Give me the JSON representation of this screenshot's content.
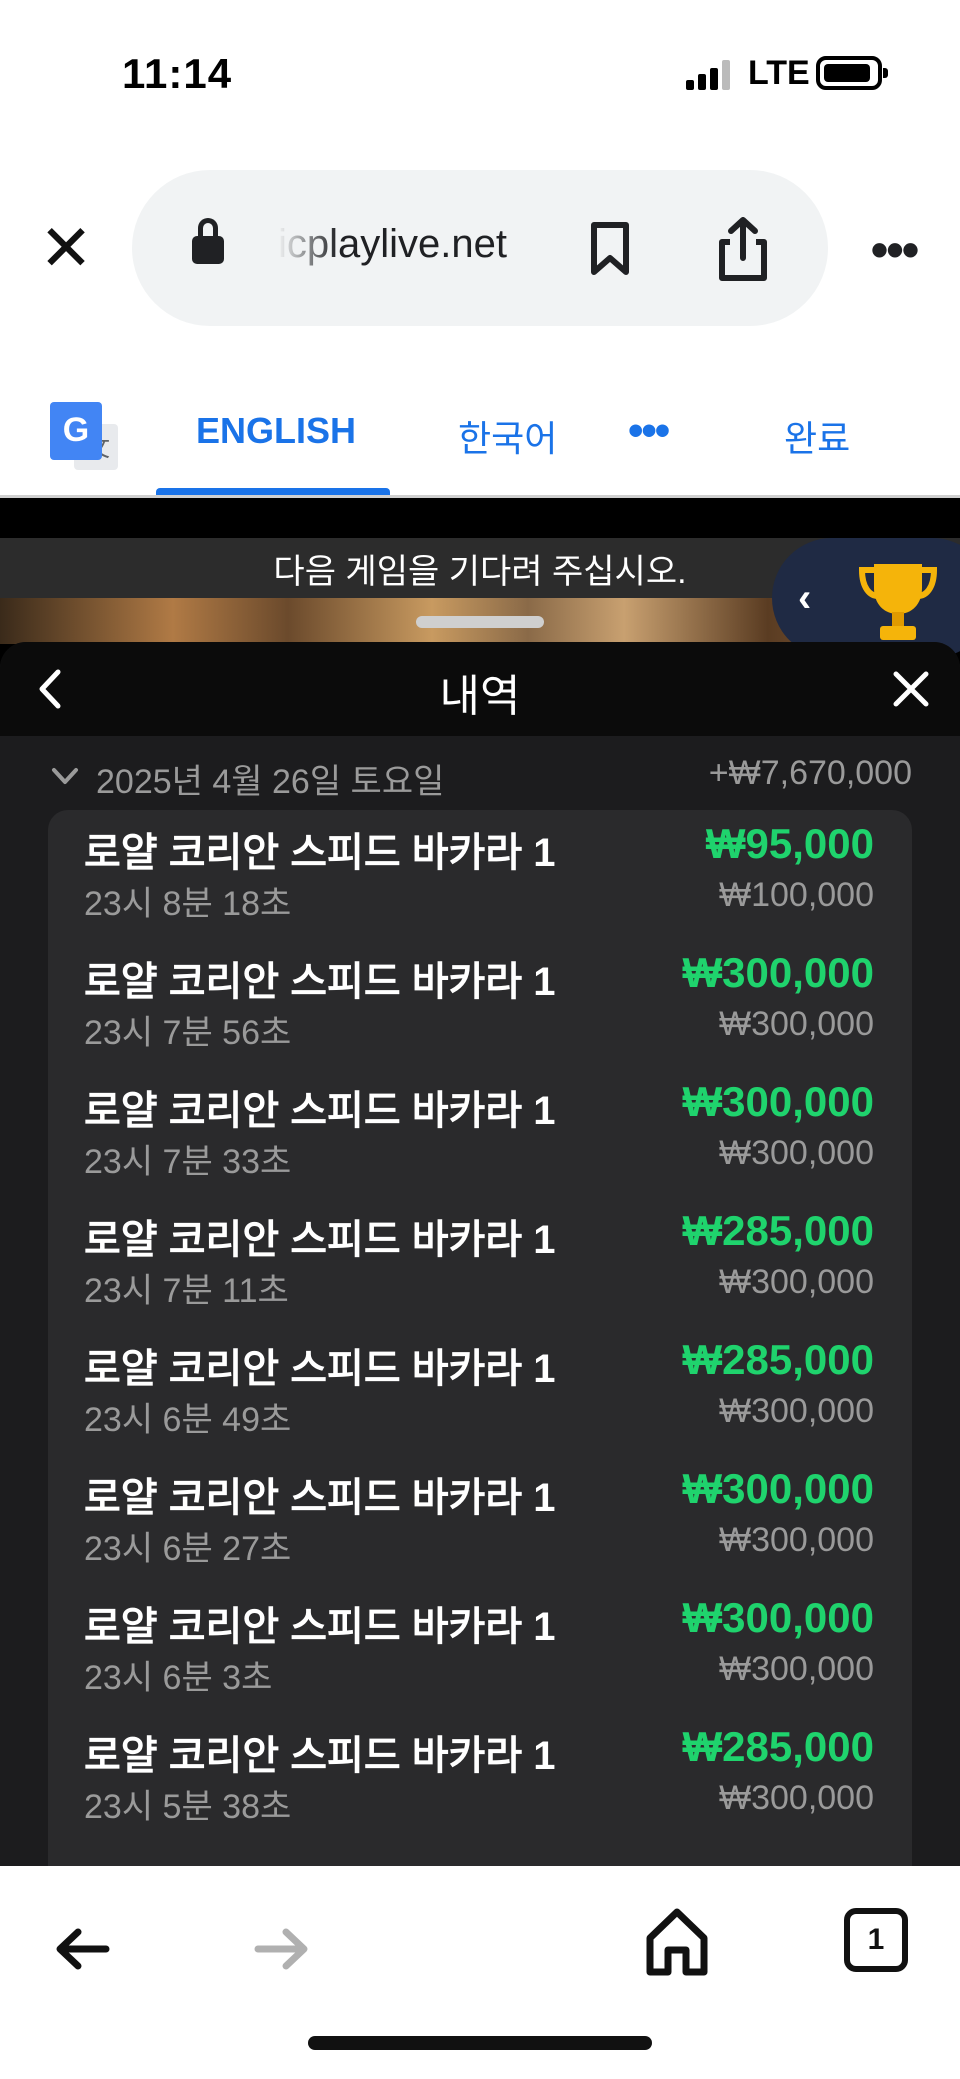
{
  "status_bar": {
    "time": "11:14",
    "network": "LTE"
  },
  "browser": {
    "url": "icplaylive.net",
    "icons": [
      "close-icon",
      "lock-icon",
      "bookmark-icon",
      "share-icon",
      "more-icon"
    ]
  },
  "translate_bar": {
    "tabs": [
      {
        "label": "ENGLISH"
      },
      {
        "label": "한국어"
      }
    ],
    "more_label": "•••",
    "done_label": "완료"
  },
  "game": {
    "wait_text": "다음 게임을 기다려 주십시오.",
    "sheet_title": "내역",
    "date_label": "2025년 4월 26일 토요일",
    "date_total": "+₩7,670,000",
    "rows": [
      {
        "name": "로얄 코리안 스피드 바카라 1",
        "time": "23시 8분 18초",
        "payout": "₩95,000",
        "stake": "₩100,000"
      },
      {
        "name": "로얄 코리안 스피드 바카라 1",
        "time": "23시 7분 56초",
        "payout": "₩300,000",
        "stake": "₩300,000"
      },
      {
        "name": "로얄 코리안 스피드 바카라 1",
        "time": "23시 7분 33초",
        "payout": "₩300,000",
        "stake": "₩300,000"
      },
      {
        "name": "로얄 코리안 스피드 바카라 1",
        "time": "23시 7분 11초",
        "payout": "₩285,000",
        "stake": "₩300,000"
      },
      {
        "name": "로얄 코리안 스피드 바카라 1",
        "time": "23시 6분 49초",
        "payout": "₩285,000",
        "stake": "₩300,000"
      },
      {
        "name": "로얄 코리안 스피드 바카라 1",
        "time": "23시 6분 27초",
        "payout": "₩300,000",
        "stake": "₩300,000"
      },
      {
        "name": "로얄 코리안 스피드 바카라 1",
        "time": "23시 6분 3초",
        "payout": "₩300,000",
        "stake": "₩300,000"
      },
      {
        "name": "로얄 코리안 스피드 바카라 1",
        "time": "23시 5분 38초",
        "payout": "₩285,000",
        "stake": "₩300,000"
      }
    ]
  },
  "bottom_bar": {
    "tab_count": "1"
  },
  "colors": {
    "accent_blue": "#1a73e8",
    "win_green": "#1fd36d",
    "sheet_bg": "#1c1c1e"
  }
}
